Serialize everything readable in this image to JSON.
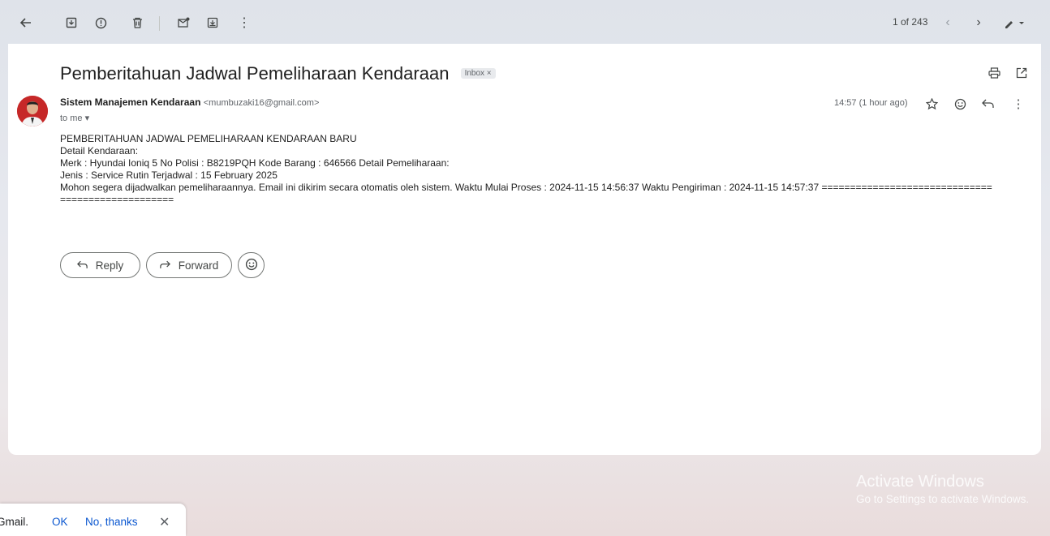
{
  "toolbar": {
    "pager": "1 of 243"
  },
  "email": {
    "subject": "Pemberitahuan Jadwal Pemeliharaan Kendaraan",
    "label_badge": "Inbox ×",
    "sender_name": "Sistem Manajemen Kendaraan",
    "sender_email": "<mumbuzaki16@gmail.com>",
    "to_label": "to me ▾",
    "time": "14:57 (1 hour ago)",
    "body_lines": [
      "PEMBERITAHUAN JADWAL PEMELIHARAAN KENDARAAN BARU",
      "Detail Kendaraan:",
      "Merk : Hyundai Ioniq 5 No Polisi : B8219PQH Kode Barang : 646566 Detail Pemeliharaan:",
      "Jenis : Service Rutin Terjadwal : 15 February 2025",
      "Mohon segera dijadwalkan pemeliharaannya. Email ini dikirim secara otomatis oleh sistem. Waktu Mulai Proses : 2024-11-15 14:56:37 Waktu Pengiriman : 2024-11-15 14:57:37 ==============================",
      "===================="
    ]
  },
  "actions": {
    "reply_label": "Reply",
    "forward_label": "Forward"
  },
  "watermark": {
    "title": "Activate Windows",
    "subtitle": "Go to Settings to activate Windows."
  },
  "toast": {
    "text": "Gmail.",
    "ok_label": "OK",
    "no_label": "No, thanks"
  },
  "colors": {
    "link_blue": "#0b57d0",
    "avatar_red": "#c62828"
  }
}
